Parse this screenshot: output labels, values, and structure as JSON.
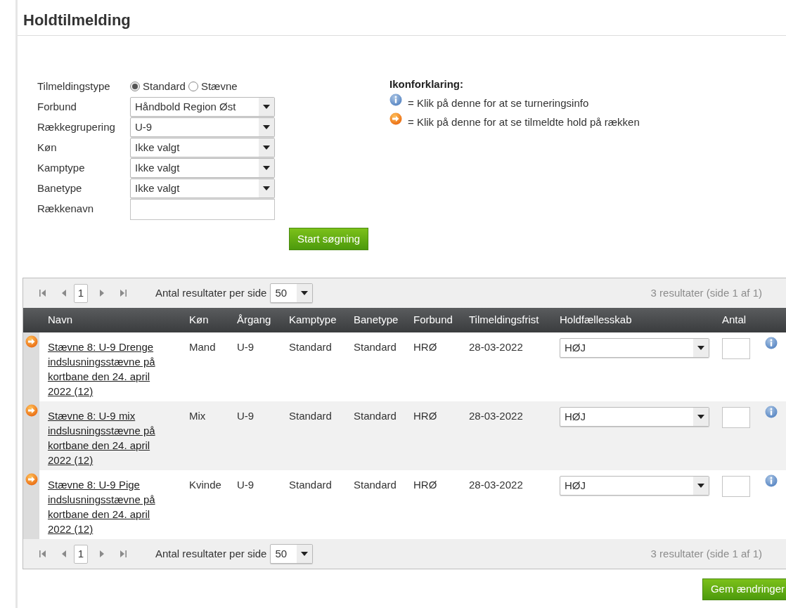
{
  "page_title": "Holdtilmelding",
  "form": {
    "fields": [
      {
        "kind": "radio",
        "label": "Tilmeldingstype",
        "options": [
          {
            "label": "Standard",
            "selected": true
          },
          {
            "label": "Stævne",
            "selected": false
          }
        ]
      },
      {
        "kind": "select",
        "label": "Forbund",
        "value": "Håndbold Region Øst"
      },
      {
        "kind": "select",
        "label": "Rækkegrupering",
        "value": "U-9"
      },
      {
        "kind": "select",
        "label": "Køn",
        "value": "Ikke valgt"
      },
      {
        "kind": "select",
        "label": "Kamptype",
        "value": "Ikke valgt"
      },
      {
        "kind": "select",
        "label": "Banetype",
        "value": "Ikke valgt"
      },
      {
        "kind": "text",
        "label": "Rækkenavn"
      }
    ],
    "search_button": "Start søgning"
  },
  "legend": {
    "title": "Ikonforklaring:",
    "items": [
      {
        "kind": "info",
        "text": "= Klik på denne for at se turneringsinfo"
      },
      {
        "kind": "arrow",
        "text": "= Klik på denne for at se tilmeldte hold på rækken"
      }
    ]
  },
  "grid": {
    "pager_top": {
      "page": "1",
      "per_page_label": "Antal resultater per side",
      "per_page": "50",
      "summary": "3 resultater (side 1 af 1)"
    },
    "columns": [
      "Navn",
      "Køn",
      "Årgang",
      "Kamptype",
      "Banetype",
      "Forbund",
      "Tilmeldingsfrist",
      "Holdfællesskab",
      "Antal"
    ],
    "rows": [
      {
        "name": "Stævne 8: U-9 Drenge indslusningsstævne på kortbane den 24. april 2022 (12)",
        "gender": "Mand",
        "year": "U-9",
        "match_type": "Standard",
        "court_type": "Standard",
        "federation": "HRØ",
        "deadline": "28-03-2022",
        "club": "HØJ"
      },
      {
        "name": "Stævne 8: U-9 mix indslusningsstævne på kortbane den 24. april 2022 (12)",
        "gender": "Mix",
        "year": "U-9",
        "match_type": "Standard",
        "court_type": "Standard",
        "federation": "HRØ",
        "deadline": "28-03-2022",
        "club": "HØJ"
      },
      {
        "name": "Stævne 8: U-9 Pige indslusningsstævne på kortbane den 24. april 2022 (12)",
        "gender": "Kvinde",
        "year": "U-9",
        "match_type": "Standard",
        "court_type": "Standard",
        "federation": "HRØ",
        "deadline": "28-03-2022",
        "club": "HØJ"
      }
    ],
    "pager_bottom": {
      "page": "1",
      "per_page_label": "Antal resultater per side",
      "per_page": "50",
      "summary": "3 resultater (side 1 af 1)"
    }
  },
  "save_button": "Gem ændringer"
}
